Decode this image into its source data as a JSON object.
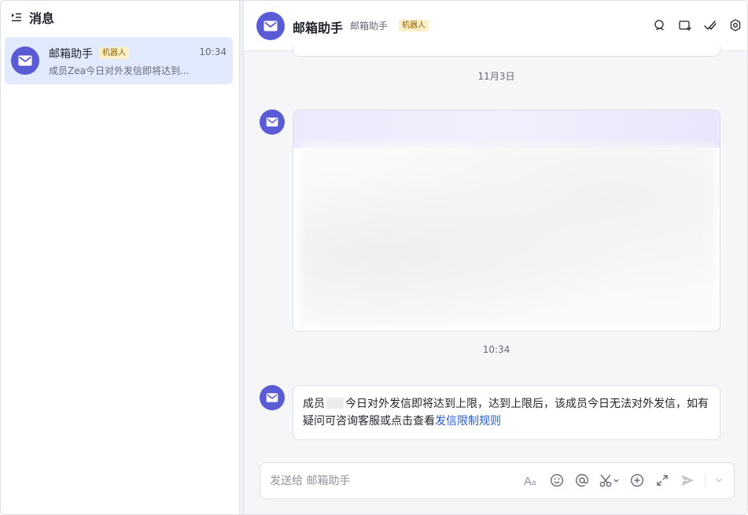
{
  "sidebar": {
    "title": "消息",
    "conversation": {
      "name": "邮箱助手",
      "tag": "机器人",
      "time": "10:34",
      "preview": "成员Zea今日对外发信即将达到..."
    }
  },
  "chat": {
    "title": "邮箱助手",
    "subtitle": "邮箱助手",
    "tag": "机器人",
    "date_separator": "11月3日",
    "time_separator": "10:34",
    "message": {
      "text_before": "成员",
      "text_after": "今日对外发信即将达到上限，达到上限后，该成员今日无法对外发信，如有疑问可咨询客服或点击查看",
      "link": "发信限制规则"
    },
    "input_placeholder": "发送给 邮箱助手"
  },
  "colors": {
    "brand": "#5b5bd6",
    "selected_bg": "#e1eaff",
    "tag_bg": "#fdf0c8",
    "link": "#245bdb"
  },
  "icons": {
    "header": [
      "search-icon",
      "add-tab-icon",
      "mark-read-icon",
      "settings-icon"
    ],
    "input": [
      "text-format-icon",
      "emoji-icon",
      "mention-icon",
      "screenshot-icon",
      "add-icon",
      "expand-icon",
      "send-icon",
      "send-options-icon"
    ]
  }
}
